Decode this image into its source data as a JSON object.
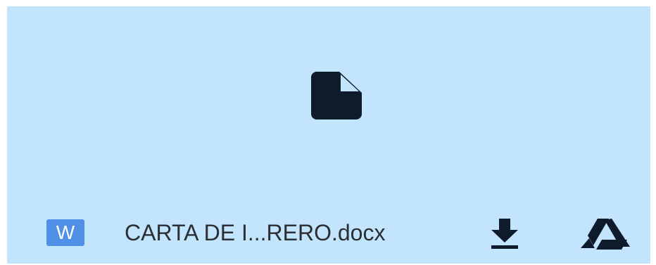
{
  "preview": {
    "icon": "file-icon"
  },
  "attachment": {
    "type_badge": "W",
    "file_name": "CARTA DE I...RERO.docx",
    "download_icon": "download-icon",
    "drive_icon": "google-drive-icon"
  },
  "colors": {
    "background": "#c2e4fd",
    "word_badge": "#4f8fe6",
    "icon": "#0d1b2a"
  }
}
